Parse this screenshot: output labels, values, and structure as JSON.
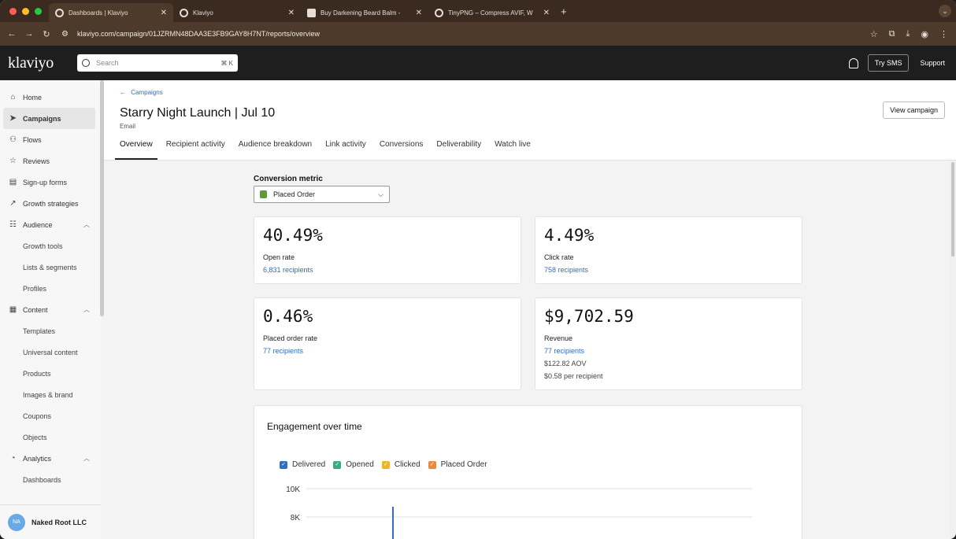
{
  "browser": {
    "tabs": [
      {
        "title": "Dashboards | Klaviyo",
        "active": true
      },
      {
        "title": "Klaviyo",
        "active": false
      },
      {
        "title": "Buy Darkening Beard Balm -",
        "active": false
      },
      {
        "title": "TinyPNG – Compress AVIF, W",
        "active": false
      }
    ],
    "url": "klaviyo.com/campaign/01JZRMN48DAA3E3FB9GAY8H7NT/reports/overview",
    "new_tab": "+"
  },
  "header": {
    "logo": "klaviyo",
    "search_placeholder": "Search",
    "search_shortcut": "⌘ K",
    "try_sms": "Try SMS",
    "support": "Support"
  },
  "sidebar": {
    "items": [
      {
        "label": "Home",
        "icon": "home-icon"
      },
      {
        "label": "Campaigns",
        "icon": "send-icon",
        "active": true
      },
      {
        "label": "Flows",
        "icon": "flows-icon"
      },
      {
        "label": "Reviews",
        "icon": "star-icon"
      },
      {
        "label": "Sign-up forms",
        "icon": "form-icon"
      },
      {
        "label": "Growth strategies",
        "icon": "trend-icon"
      },
      {
        "label": "Audience",
        "icon": "audience-icon"
      }
    ],
    "audience_sub": [
      "Growth tools",
      "Lists & segments",
      "Profiles"
    ],
    "content": "Content",
    "content_sub": [
      "Templates",
      "Universal content",
      "Products",
      "Images & brand",
      "Coupons",
      "Objects"
    ],
    "analytics": "Analytics",
    "analytics_sub": [
      "Dashboards"
    ],
    "workspace_initials": "NA",
    "workspace_name": "Naked Root LLC"
  },
  "page": {
    "breadcrumb": "Campaigns",
    "title": "Starry Night Launch | Jul 10",
    "subtitle": "Email",
    "view_button": "View campaign",
    "tabs": [
      "Overview",
      "Recipient activity",
      "Audience breakdown",
      "Link activity",
      "Conversions",
      "Deliverability",
      "Watch live"
    ]
  },
  "metric": {
    "label": "Conversion metric",
    "selected": "Placed Order"
  },
  "cards": {
    "open": {
      "value": "40.49%",
      "label": "Open rate",
      "link": "6,831 recipients"
    },
    "click": {
      "value": "4.49%",
      "label": "Click rate",
      "link": "758 recipients"
    },
    "placed": {
      "value": "0.46%",
      "label": "Placed order rate",
      "link": "77 recipients"
    },
    "revenue": {
      "value": "$9,702.59",
      "label": "Revenue",
      "link": "77 recipients",
      "aov": "$122.82 AOV",
      "per_recipient": "$0.58 per recipient"
    }
  },
  "engagement": {
    "title": "Engagement over time",
    "legend": [
      {
        "name": "Delivered",
        "color": "#2f6fc4"
      },
      {
        "name": "Opened",
        "color": "#3aaa86"
      },
      {
        "name": "Clicked",
        "color": "#f0b620"
      },
      {
        "name": "Placed Order",
        "color": "#ea8a3c"
      }
    ],
    "y_ticks": [
      "10K",
      "8K"
    ]
  }
}
